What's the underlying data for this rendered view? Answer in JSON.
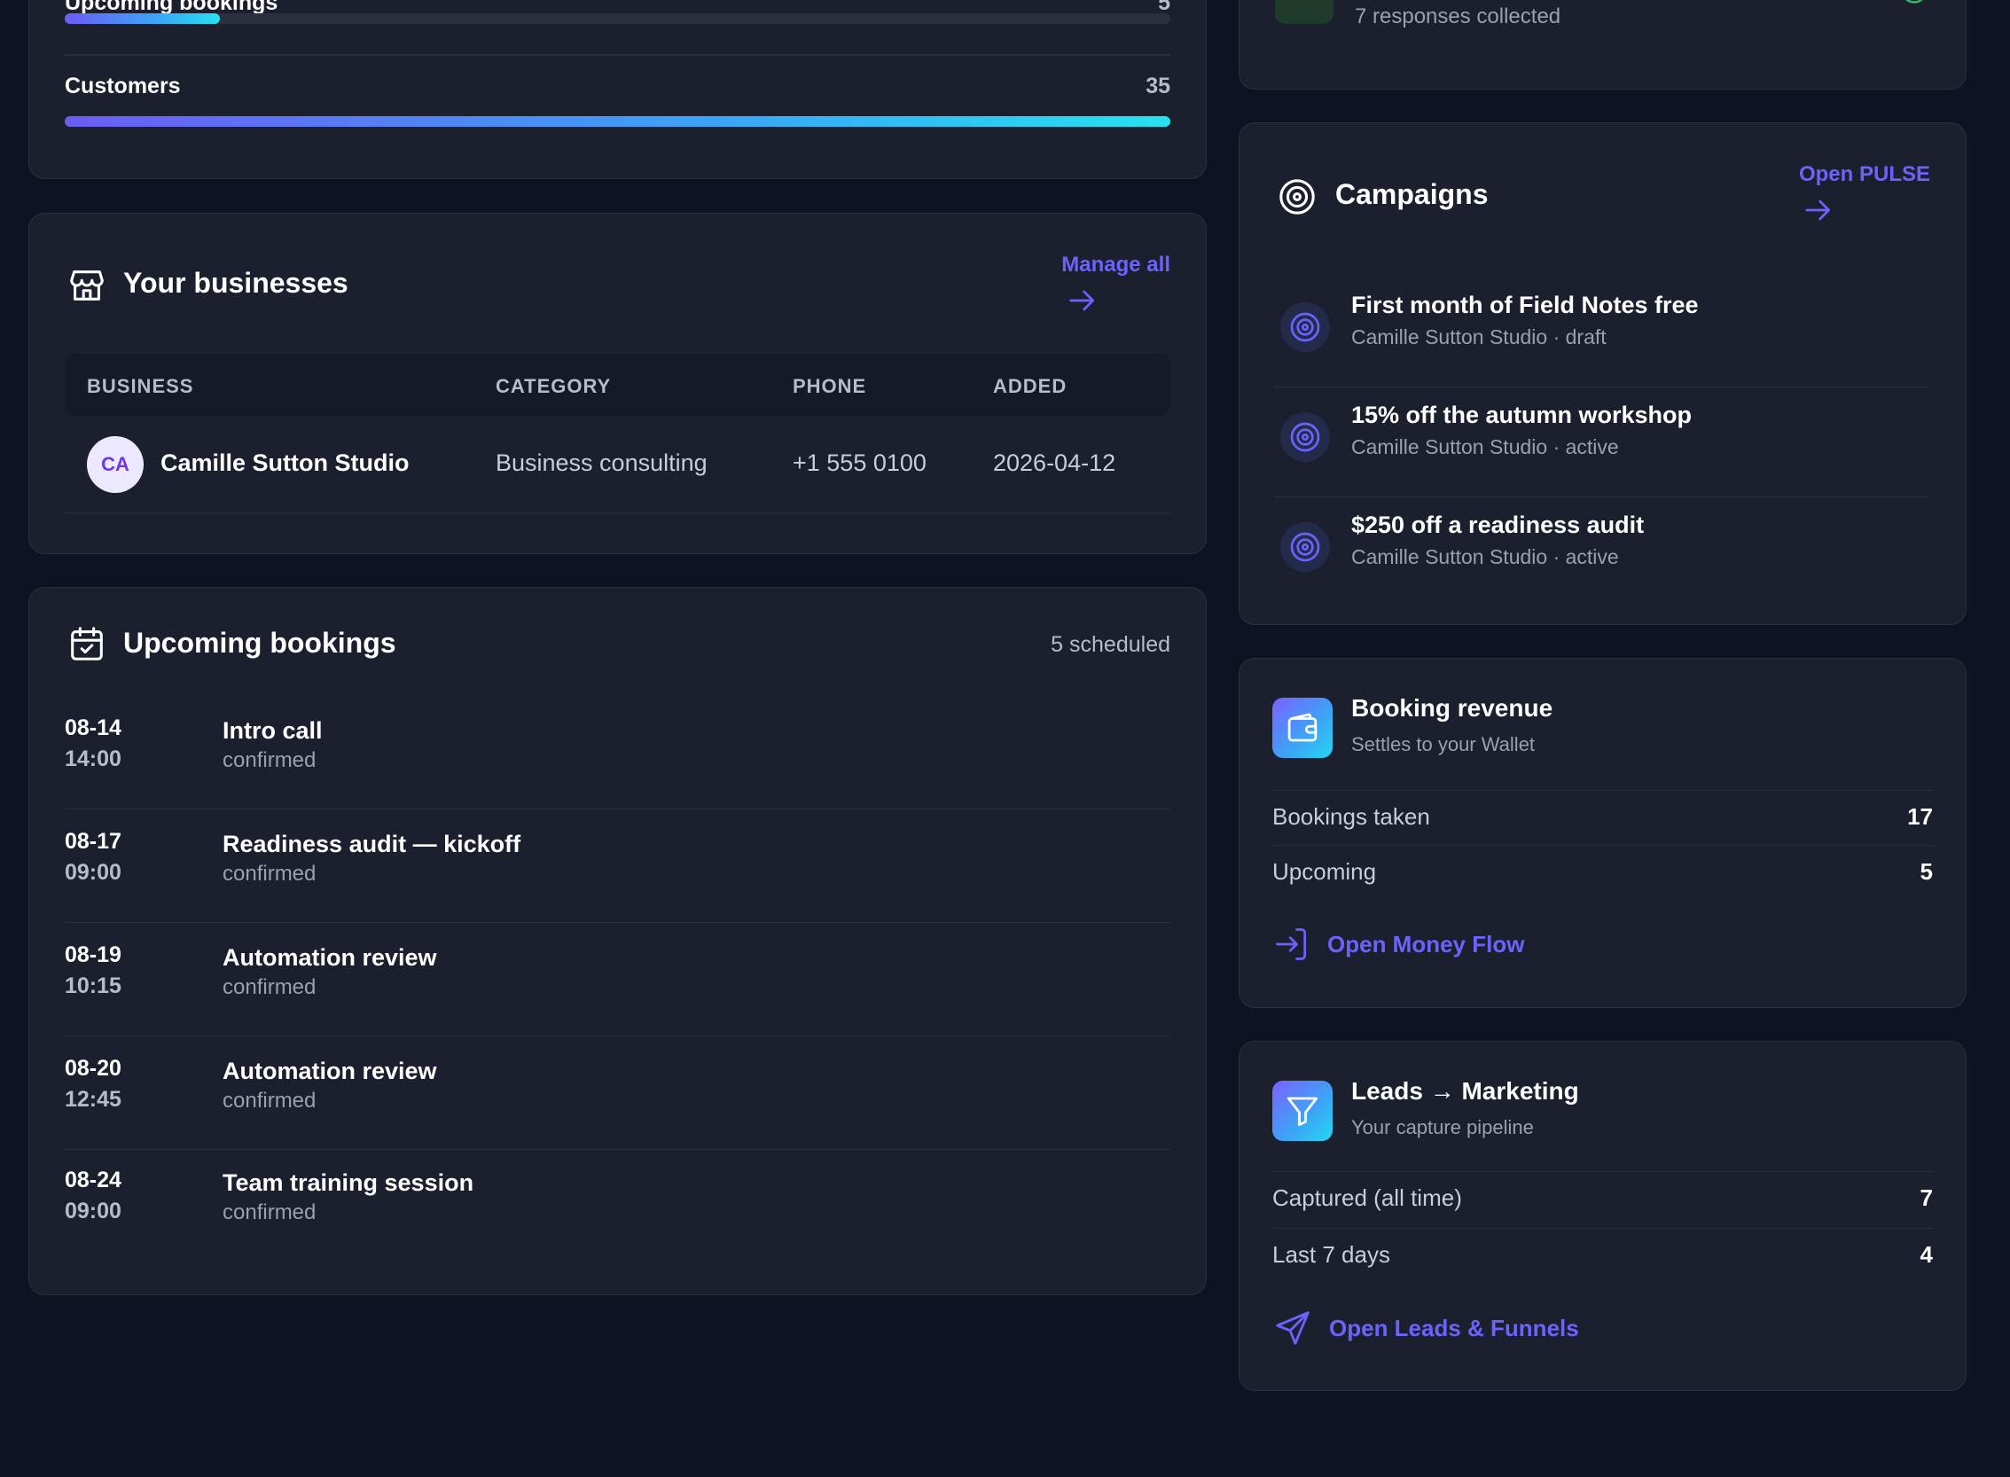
{
  "progress": {
    "rows": [
      {
        "label": "Upcoming bookings",
        "value": "5",
        "fraction": 0.14
      },
      {
        "label": "Customers",
        "value": "35",
        "fraction": 1.0
      }
    ]
  },
  "businesses": {
    "title": "Your businesses",
    "manage_label": "Manage all",
    "columns": [
      "BUSINESS",
      "CATEGORY",
      "PHONE",
      "ADDED"
    ],
    "rows": [
      {
        "initials": "CA",
        "name": "Camille Sutton Studio",
        "category": "Business consulting",
        "phone": "+1 555 0100",
        "added": "2026-04-12"
      }
    ]
  },
  "bookings": {
    "title": "Upcoming bookings",
    "count_label": "5 scheduled",
    "items": [
      {
        "date": "08-14",
        "time": "14:00",
        "title": "Intro call",
        "status": "confirmed"
      },
      {
        "date": "08-17",
        "time": "09:00",
        "title": "Readiness audit — kickoff",
        "status": "confirmed"
      },
      {
        "date": "08-19",
        "time": "10:15",
        "title": "Automation review",
        "status": "confirmed"
      },
      {
        "date": "08-20",
        "time": "12:45",
        "title": "Automation review",
        "status": "confirmed"
      },
      {
        "date": "08-24",
        "time": "09:00",
        "title": "Team training session",
        "status": "confirmed"
      }
    ]
  },
  "responses": {
    "subtitle": "7 responses collected"
  },
  "campaigns": {
    "title": "Campaigns",
    "open_label": "Open PULSE",
    "items": [
      {
        "title": "First month of Field Notes free",
        "sub": "Camille Sutton Studio · draft"
      },
      {
        "title": "15% off the autumn workshop",
        "sub": "Camille Sutton Studio · active"
      },
      {
        "title": "$250 off a readiness audit",
        "sub": "Camille Sutton Studio · active"
      }
    ]
  },
  "revenue": {
    "title": "Booking revenue",
    "subtitle": "Settles to your Wallet",
    "stats": [
      {
        "label": "Bookings taken",
        "value": "17"
      },
      {
        "label": "Upcoming",
        "value": "5"
      }
    ],
    "link_label": "Open Money Flow"
  },
  "leads": {
    "title": "Leads → Marketing",
    "subtitle": "Your capture pipeline",
    "stats": [
      {
        "label": "Captured (all time)",
        "value": "7"
      },
      {
        "label": "Last 7 days",
        "value": "4"
      }
    ],
    "link_label": "Open Leads & Funnels"
  },
  "colors": {
    "background": "#0d1322",
    "card": "#1b1f2e",
    "accent": "#6c63ff",
    "gradient_end": "#25e2f0"
  },
  "icons": {
    "businesses": "storefront-icon",
    "bookings": "calendar-check-icon",
    "campaigns": "target-icon",
    "revenue": "wallet-icon",
    "leads": "funnel-icon",
    "money_link": "log-in-arrow-icon",
    "leads_link": "send-icon"
  }
}
